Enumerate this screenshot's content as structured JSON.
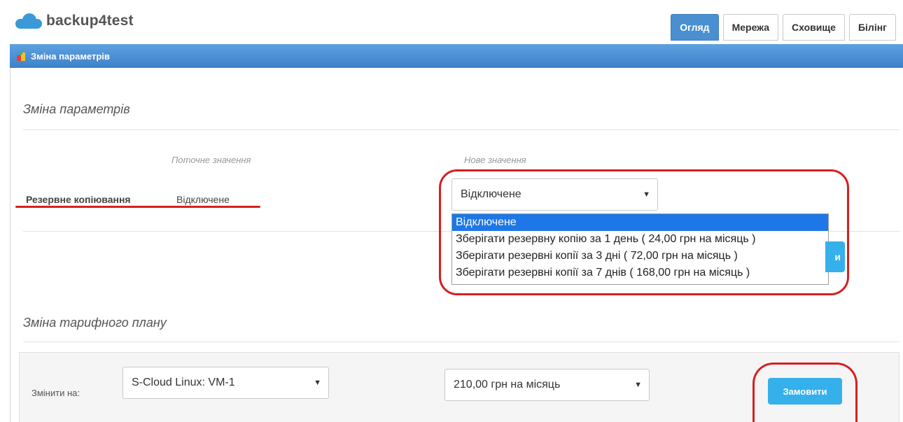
{
  "app": {
    "name": "backup4test"
  },
  "nav": {
    "tabs": [
      {
        "label": "Огляд",
        "active": true
      },
      {
        "label": "Мережа",
        "active": false
      },
      {
        "label": "Сховище",
        "active": false
      },
      {
        "label": "Білінг",
        "active": false
      }
    ]
  },
  "panel": {
    "title": "Зміна параметрів"
  },
  "params": {
    "heading": "Зміна параметрів",
    "current_header": "Поточне значення",
    "new_header": "Нове значення",
    "row": {
      "label": "Резервне копіювання",
      "current_value": "Відключене",
      "selected_value": "Відключене"
    },
    "options": [
      "Відключене",
      "Зберігати резервну копію за 1 день ( 24,00 грн на місяць )",
      "Зберігати резервні копії за 3 дні ( 72,00 грн на місяць )",
      "Зберігати резервні копії за 7 днів ( 168,00 грн на місяць )"
    ],
    "partial_button_text": "и"
  },
  "plan": {
    "heading": "Зміна тарифного плану",
    "change_label": "Змінити на:",
    "plan_selected": "S-Cloud Linux: VM-1",
    "price_selected": "210,00 грн на місяць",
    "order_button": "Замовити"
  },
  "colors": {
    "accent_blue": "#4a90d1",
    "button_blue": "#35b0ea",
    "annotation_red": "#d62020",
    "selected_option": "#1e77e6"
  }
}
